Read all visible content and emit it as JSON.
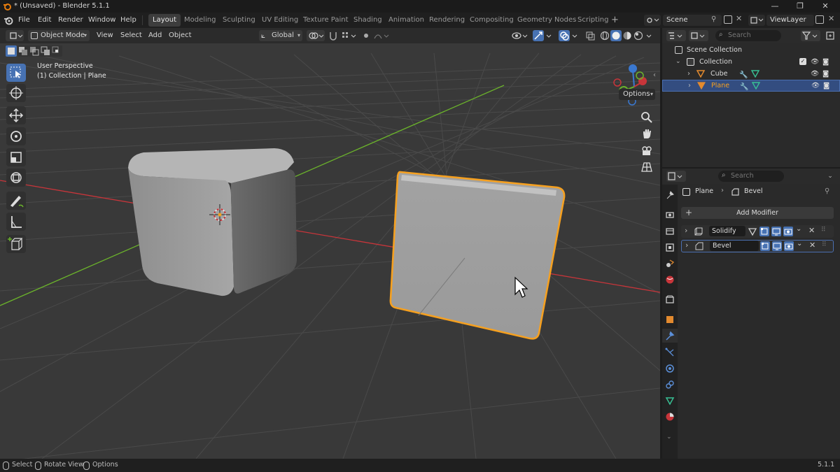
{
  "window": {
    "title": "* (Unsaved) - Blender 5.1.1"
  },
  "menu": {
    "file": "File",
    "edit": "Edit",
    "render": "Render",
    "window": "Window",
    "help": "Help"
  },
  "workspaces": [
    "Layout",
    "Modeling",
    "Sculpting",
    "UV Editing",
    "Texture Paint",
    "Shading",
    "Animation",
    "Rendering",
    "Compositing",
    "Geometry Nodes",
    "Scripting"
  ],
  "scene": {
    "name": "Scene",
    "view_layer": "ViewLayer"
  },
  "viewport_header": {
    "mode": "Object Mode",
    "view": "View",
    "select": "Select",
    "add": "Add",
    "object": "Object",
    "orientation": "Global",
    "options": "Options"
  },
  "viewport": {
    "perspective": "User Perspective",
    "collection_info": "(1) Collection | Plane"
  },
  "outliner": {
    "search_placeholder": "Search",
    "scene_collection": "Scene Collection",
    "collection": "Collection",
    "cube": "Cube",
    "plane": "Plane"
  },
  "properties": {
    "search_placeholder": "Search",
    "object": "Plane",
    "modifier_crumb": "Bevel",
    "add_modifier": "Add Modifier",
    "modifiers": [
      "Solidify",
      "Bevel"
    ]
  },
  "statusbar": {
    "select": "Select",
    "rotate": "Rotate View",
    "options": "Options",
    "version": "5.1.1"
  },
  "colors": {
    "accent": "#4772b3",
    "selection_outline": "#f5a020",
    "x_axis": "#c8353a",
    "y_axis": "#6bb32b"
  }
}
